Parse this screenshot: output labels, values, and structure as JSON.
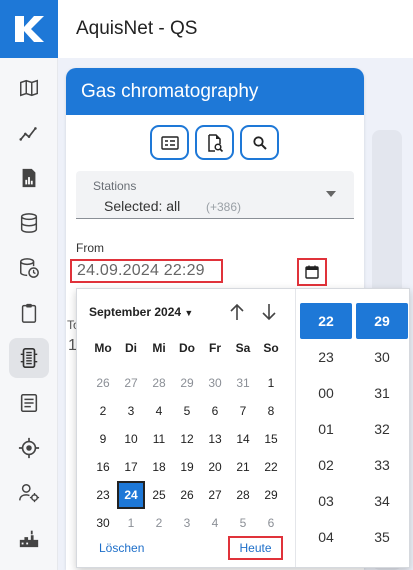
{
  "app": {
    "title": "AquisNet - QS"
  },
  "sidebar": {
    "items": [
      {
        "icon": "map-icon",
        "active": false
      },
      {
        "icon": "trend-icon",
        "active": false
      },
      {
        "icon": "report-icon",
        "active": false
      },
      {
        "icon": "database-icon",
        "active": false
      },
      {
        "icon": "database-clock-icon",
        "active": false
      },
      {
        "icon": "clipboard-icon",
        "active": false
      },
      {
        "icon": "chromatography-icon",
        "active": true
      },
      {
        "icon": "document-icon",
        "active": false
      },
      {
        "icon": "target-icon",
        "active": false
      },
      {
        "icon": "user-settings-icon",
        "active": false
      },
      {
        "icon": "plant-icon",
        "active": false
      }
    ]
  },
  "panel": {
    "title": "Gas chromatography",
    "toolbar": {
      "buttons": [
        "form-list-icon",
        "file-search-icon",
        "search-icon"
      ]
    },
    "stations": {
      "label": "Stations",
      "value": "Selected: all",
      "count": "(+386)"
    },
    "from": {
      "label": "From",
      "value": "24.09.2024 22:29"
    },
    "ghost": {
      "to_prefix": "To",
      "digit": "1"
    }
  },
  "datepicker": {
    "month_label": "September 2024",
    "weekdays": [
      "Mo",
      "Di",
      "Mi",
      "Do",
      "Fr",
      "Sa",
      "So"
    ],
    "weeks": [
      [
        {
          "d": "26",
          "m": true
        },
        {
          "d": "27",
          "m": true
        },
        {
          "d": "28",
          "m": true
        },
        {
          "d": "29",
          "m": true
        },
        {
          "d": "30",
          "m": true
        },
        {
          "d": "31",
          "m": true
        },
        {
          "d": "1",
          "m": false
        }
      ],
      [
        {
          "d": "2",
          "m": false
        },
        {
          "d": "3",
          "m": false
        },
        {
          "d": "4",
          "m": false
        },
        {
          "d": "5",
          "m": false
        },
        {
          "d": "6",
          "m": false
        },
        {
          "d": "7",
          "m": false
        },
        {
          "d": "8",
          "m": false
        }
      ],
      [
        {
          "d": "9",
          "m": false
        },
        {
          "d": "10",
          "m": false
        },
        {
          "d": "11",
          "m": false
        },
        {
          "d": "12",
          "m": false
        },
        {
          "d": "13",
          "m": false
        },
        {
          "d": "14",
          "m": false
        },
        {
          "d": "15",
          "m": false
        }
      ],
      [
        {
          "d": "16",
          "m": false
        },
        {
          "d": "17",
          "m": false
        },
        {
          "d": "18",
          "m": false
        },
        {
          "d": "19",
          "m": false
        },
        {
          "d": "20",
          "m": false
        },
        {
          "d": "21",
          "m": false
        },
        {
          "d": "22",
          "m": false
        }
      ],
      [
        {
          "d": "23",
          "m": false
        },
        {
          "d": "24",
          "m": false,
          "sel": true
        },
        {
          "d": "25",
          "m": false
        },
        {
          "d": "26",
          "m": false
        },
        {
          "d": "27",
          "m": false
        },
        {
          "d": "28",
          "m": false
        },
        {
          "d": "29",
          "m": false
        }
      ],
      [
        {
          "d": "30",
          "m": false
        },
        {
          "d": "1",
          "m": true
        },
        {
          "d": "2",
          "m": true
        },
        {
          "d": "3",
          "m": true
        },
        {
          "d": "4",
          "m": true
        },
        {
          "d": "5",
          "m": true
        },
        {
          "d": "6",
          "m": true
        }
      ]
    ],
    "clear_label": "Löschen",
    "today_label": "Heute",
    "hours": [
      "22",
      "23",
      "00",
      "01",
      "02",
      "03",
      "04"
    ],
    "minutes": [
      "29",
      "30",
      "31",
      "32",
      "33",
      "34",
      "35"
    ],
    "selected_hour": "22",
    "selected_minute": "29"
  },
  "colors": {
    "brand": "#1e78d7",
    "highlight": "#e0323a"
  }
}
